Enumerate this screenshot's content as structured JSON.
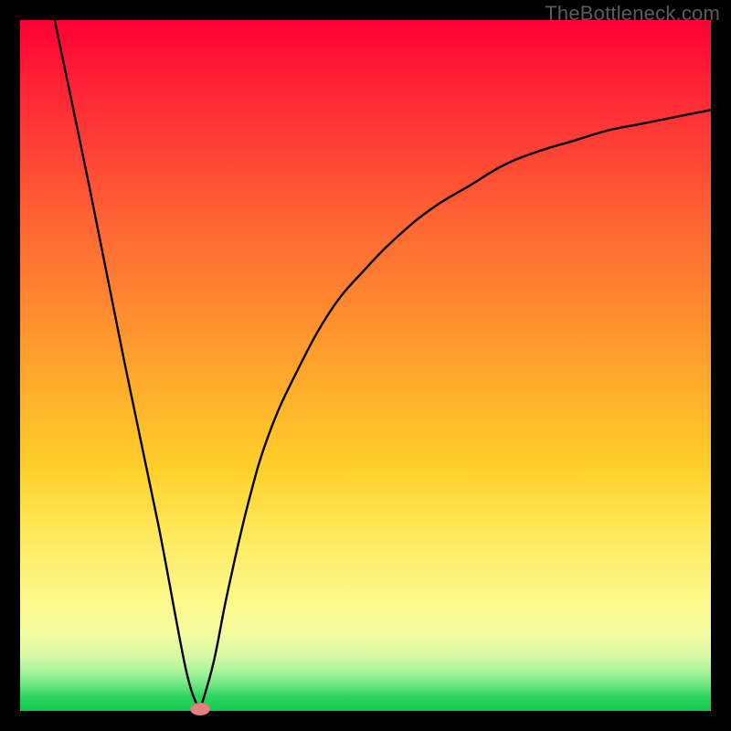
{
  "watermark": "TheBottleneck.com",
  "colors": {
    "background": "#000000",
    "gradient_top": "#ff0033",
    "gradient_bottom": "#0fc94c",
    "curve": "#000000",
    "marker": "#e2817e"
  },
  "chart_data": {
    "type": "line",
    "title": "",
    "xlabel": "",
    "ylabel": "",
    "xlim": [
      0,
      100
    ],
    "ylim": [
      0,
      100
    ],
    "grid": false,
    "legend": false,
    "series": [
      {
        "name": "curve",
        "x": [
          5,
          10,
          15,
          20,
          24,
          26,
          28,
          30,
          33,
          36,
          40,
          45,
          50,
          55,
          60,
          65,
          70,
          75,
          80,
          85,
          90,
          95,
          100
        ],
        "y": [
          100,
          76,
          51,
          27,
          6,
          0,
          7,
          17,
          30,
          40,
          49,
          58,
          64,
          69,
          73,
          76,
          79,
          81,
          82.5,
          84,
          85,
          86,
          87
        ]
      }
    ],
    "annotations": [
      {
        "name": "marker",
        "x": 26,
        "y": 0,
        "shape": "ellipse",
        "color": "#e2817e"
      }
    ],
    "notes": "V-shaped curve on vertical red→yellow→green gradient; minimum near x≈26. No axis ticks or labels visible."
  }
}
